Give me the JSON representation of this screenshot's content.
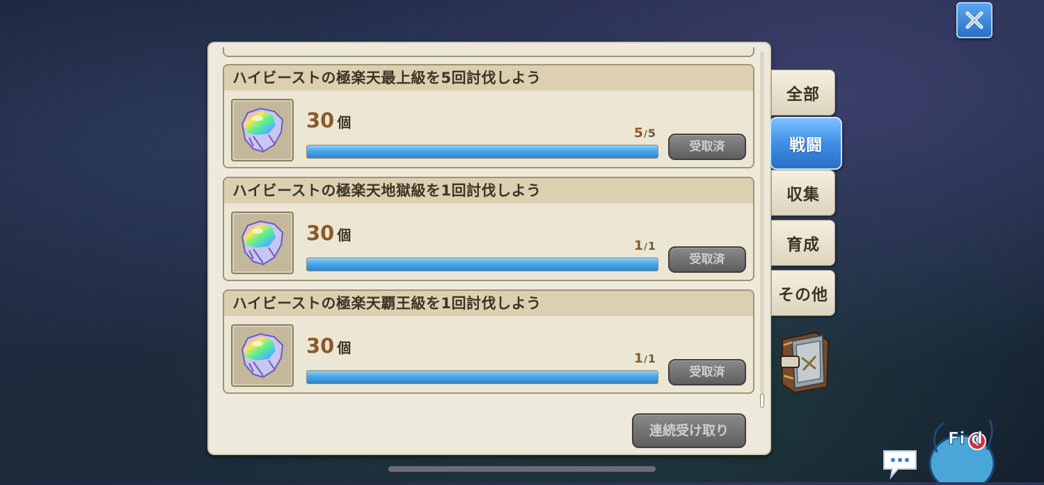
{
  "missions": [
    {
      "title": "ハイビーストの極楽天最上級を5回討伐しよう",
      "amount": "30",
      "unit": "個",
      "current": "5",
      "separator": "/",
      "total": "5",
      "progress": 1.0,
      "status_label": "受取済"
    },
    {
      "title": "ハイビーストの極楽天地獄級を1回討伐しよう",
      "amount": "30",
      "unit": "個",
      "current": "1",
      "separator": "/",
      "total": "1",
      "progress": 1.0,
      "status_label": "受取済"
    },
    {
      "title": "ハイビーストの極楽天覇王級を1回討伐しよう",
      "amount": "30",
      "unit": "個",
      "current": "1",
      "separator": "/",
      "total": "1",
      "progress": 1.0,
      "status_label": "受取済"
    }
  ],
  "bulk_claim_label": "連続受け取り",
  "tabs": [
    {
      "label": "全部",
      "active": false
    },
    {
      "label": "戦闘",
      "active": true
    },
    {
      "label": "収集",
      "active": false
    },
    {
      "label": "育成",
      "active": false
    },
    {
      "label": "その他",
      "active": false
    }
  ],
  "mascot_label": "Fi d",
  "icons": {
    "close": "close-icon",
    "reward": "rainbow-crystal-icon",
    "book": "mission-book-icon",
    "chat": "chat-bubble-icon"
  },
  "colors": {
    "accent_blue": "#3f8fe6",
    "panel_bg": "#eeeadb",
    "progress_fill": "#4aa6e6",
    "claimed_button": "#6e6e6e"
  }
}
